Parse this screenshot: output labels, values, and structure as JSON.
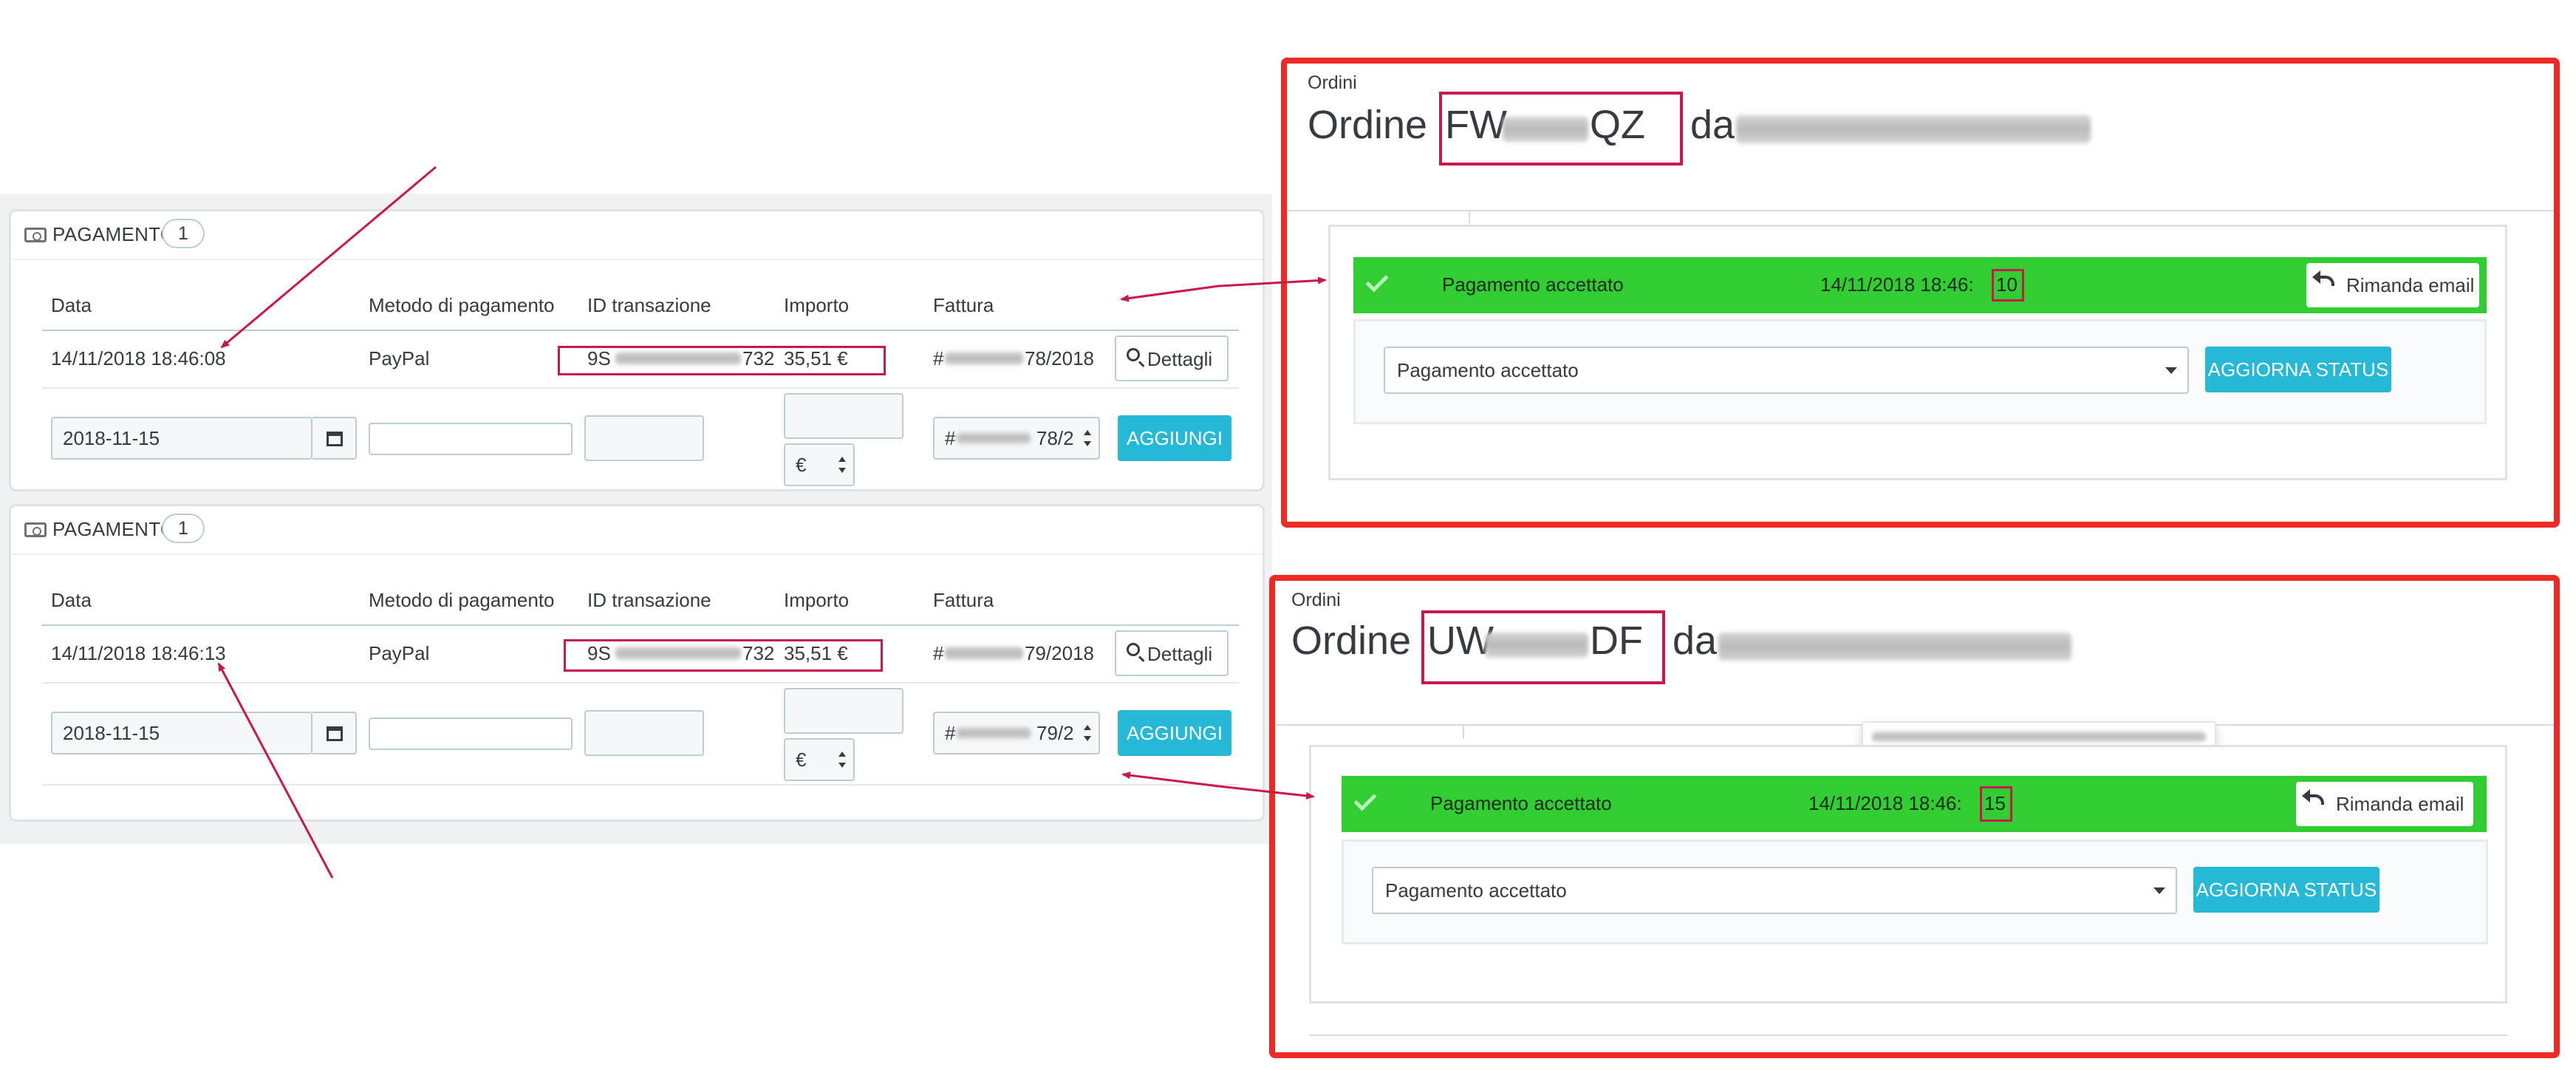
{
  "colors": {
    "accent_blue": "#25b9d7",
    "status_green": "#32cd32",
    "highlight_red": "#ee2a24",
    "annotation_crimson": "#c9184a"
  },
  "payment_panels": [
    {
      "title": "PAGAMENTO",
      "count": "1",
      "columns": [
        "Data",
        "Metodo di pagamento",
        "ID transazione",
        "Importo",
        "Fattura"
      ],
      "row": {
        "date": "14/11/2018 18:46:08",
        "method": "PayPal",
        "transaction_prefix": "9S",
        "transaction_suffix": "732",
        "amount": "35,51 €",
        "invoice_prefix": "#",
        "invoice_suffix": "78/2018",
        "details_label": "Dettagli"
      },
      "form": {
        "date_value": "2018-11-15",
        "currency": "€",
        "invoice_prefix": "#",
        "invoice_suffix": "78/2",
        "add_label": "AGGIUNGI"
      }
    },
    {
      "title": "PAGAMENTO",
      "count": "1",
      "columns": [
        "Data",
        "Metodo di pagamento",
        "ID transazione",
        "Importo",
        "Fattura"
      ],
      "row": {
        "date": "14/11/2018 18:46:13",
        "method": "PayPal",
        "transaction_prefix": "9S",
        "transaction_suffix": "732",
        "amount": "35,51 €",
        "invoice_prefix": "#",
        "invoice_suffix": "79/2018",
        "details_label": "Dettagli"
      },
      "form": {
        "date_value": "2018-11-15",
        "currency": "€",
        "invoice_prefix": "#",
        "invoice_suffix": "79/2",
        "add_label": "AGGIUNGI"
      }
    }
  ],
  "orders": [
    {
      "breadcrumb": "Ordini",
      "title_prefix": "Ordine",
      "ref_start": "FW",
      "ref_end": "QZ",
      "da": "da",
      "status_label": "Pagamento accettato",
      "status_time_prefix": "14/11/2018 18:46:",
      "status_time_seconds": "10",
      "resend_label": "Rimanda email",
      "select_value": "Pagamento accettato",
      "update_label": "AGGIORNA STATUS"
    },
    {
      "breadcrumb": "Ordini",
      "title_prefix": "Ordine",
      "ref_start": "UW",
      "ref_end": "DF",
      "da": "da",
      "status_label": "Pagamento accettato",
      "status_time_prefix": "14/11/2018 18:46:",
      "status_time_seconds": "15",
      "resend_label": "Rimanda email",
      "select_value": "Pagamento accettato",
      "update_label": "AGGIORNA STATUS"
    }
  ]
}
